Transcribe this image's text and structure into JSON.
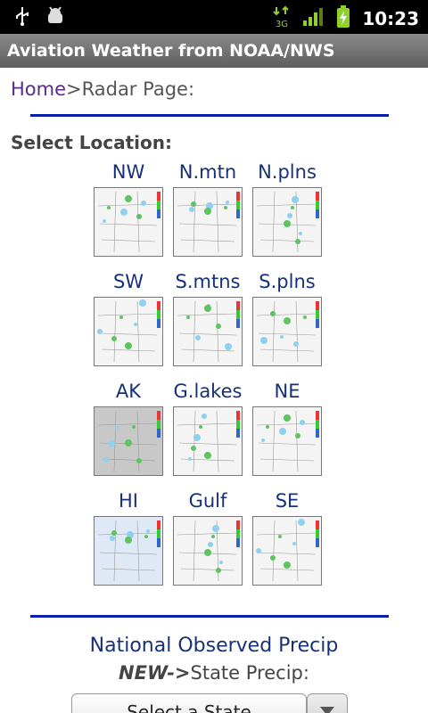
{
  "status": {
    "time": "10:23",
    "network": "3G",
    "icons": [
      "usb-icon",
      "android-debug-icon",
      "signal-3g-icon",
      "signal-bars-icon",
      "battery-charging-icon"
    ]
  },
  "app": {
    "title": "Aviation Weather from NOAA/NWS"
  },
  "breadcrumb": {
    "home": "Home",
    "current": ">Radar Page:"
  },
  "select_location_label": "Select Location:",
  "locations": [
    {
      "label": "NW"
    },
    {
      "label": "N.mtn"
    },
    {
      "label": "N.plns"
    },
    {
      "label": "SW"
    },
    {
      "label": "S.mtns"
    },
    {
      "label": "S.plns"
    },
    {
      "label": "AK"
    },
    {
      "label": "G.lakes"
    },
    {
      "label": "NE"
    },
    {
      "label": "HI"
    },
    {
      "label": "Gulf"
    },
    {
      "label": "SE"
    }
  ],
  "links": {
    "national_precip": "National Observed Precip",
    "new_prefix": "NEW->",
    "state_precip": "State Precip:"
  },
  "state_select": {
    "value": "Select a State"
  },
  "colors": {
    "rule": "#0a1fa6",
    "link": "#17307a",
    "home_link": "#5b2c8a"
  }
}
